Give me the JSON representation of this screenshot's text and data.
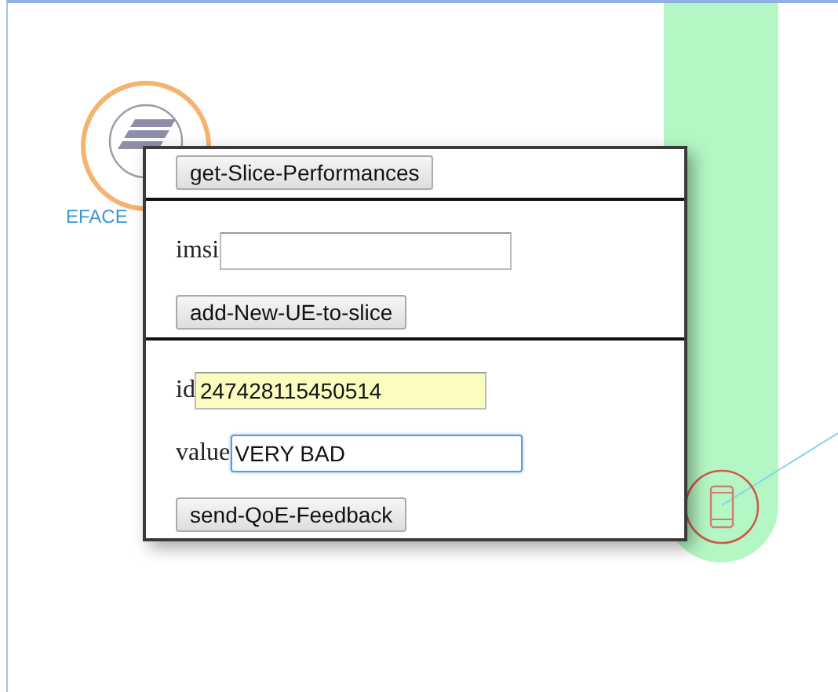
{
  "diagram": {
    "nodes": [
      {
        "kind": "server",
        "label": "EFACE"
      },
      {
        "kind": "phone"
      }
    ]
  },
  "popup": {
    "sections": [
      {
        "button": "get-Slice-Performances"
      },
      {
        "fields": [
          {
            "label": "imsi",
            "focused": false,
            "autofilled": false
          }
        ],
        "button": "add-New-UE-to-slice"
      },
      {
        "fields": [
          {
            "label": "id",
            "value": "247428115450514",
            "focused": false,
            "autofilled": true
          },
          {
            "label": "value",
            "value": "VERY BAD",
            "focused": true,
            "autofilled": false
          }
        ],
        "button": "send-QoE-Feedback"
      }
    ]
  }
}
